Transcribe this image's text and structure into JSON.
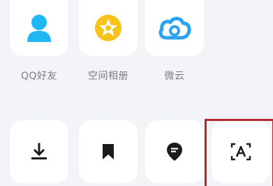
{
  "share_targets": [
    {
      "label": "QQ好友",
      "icon": "qq-friend-icon",
      "color": "#1fb6f5"
    },
    {
      "label": "空间相册",
      "icon": "qzone-album-icon",
      "color": "#f7c21a"
    },
    {
      "label": "微云",
      "icon": "weiyun-cloud-icon",
      "color": "#2aa3f2"
    }
  ],
  "actions": [
    {
      "icon": "download-icon"
    },
    {
      "icon": "bookmark-icon"
    },
    {
      "icon": "location-pin-icon"
    },
    {
      "icon": "text-recognition-icon"
    }
  ],
  "highlight_color": "#b3272d"
}
